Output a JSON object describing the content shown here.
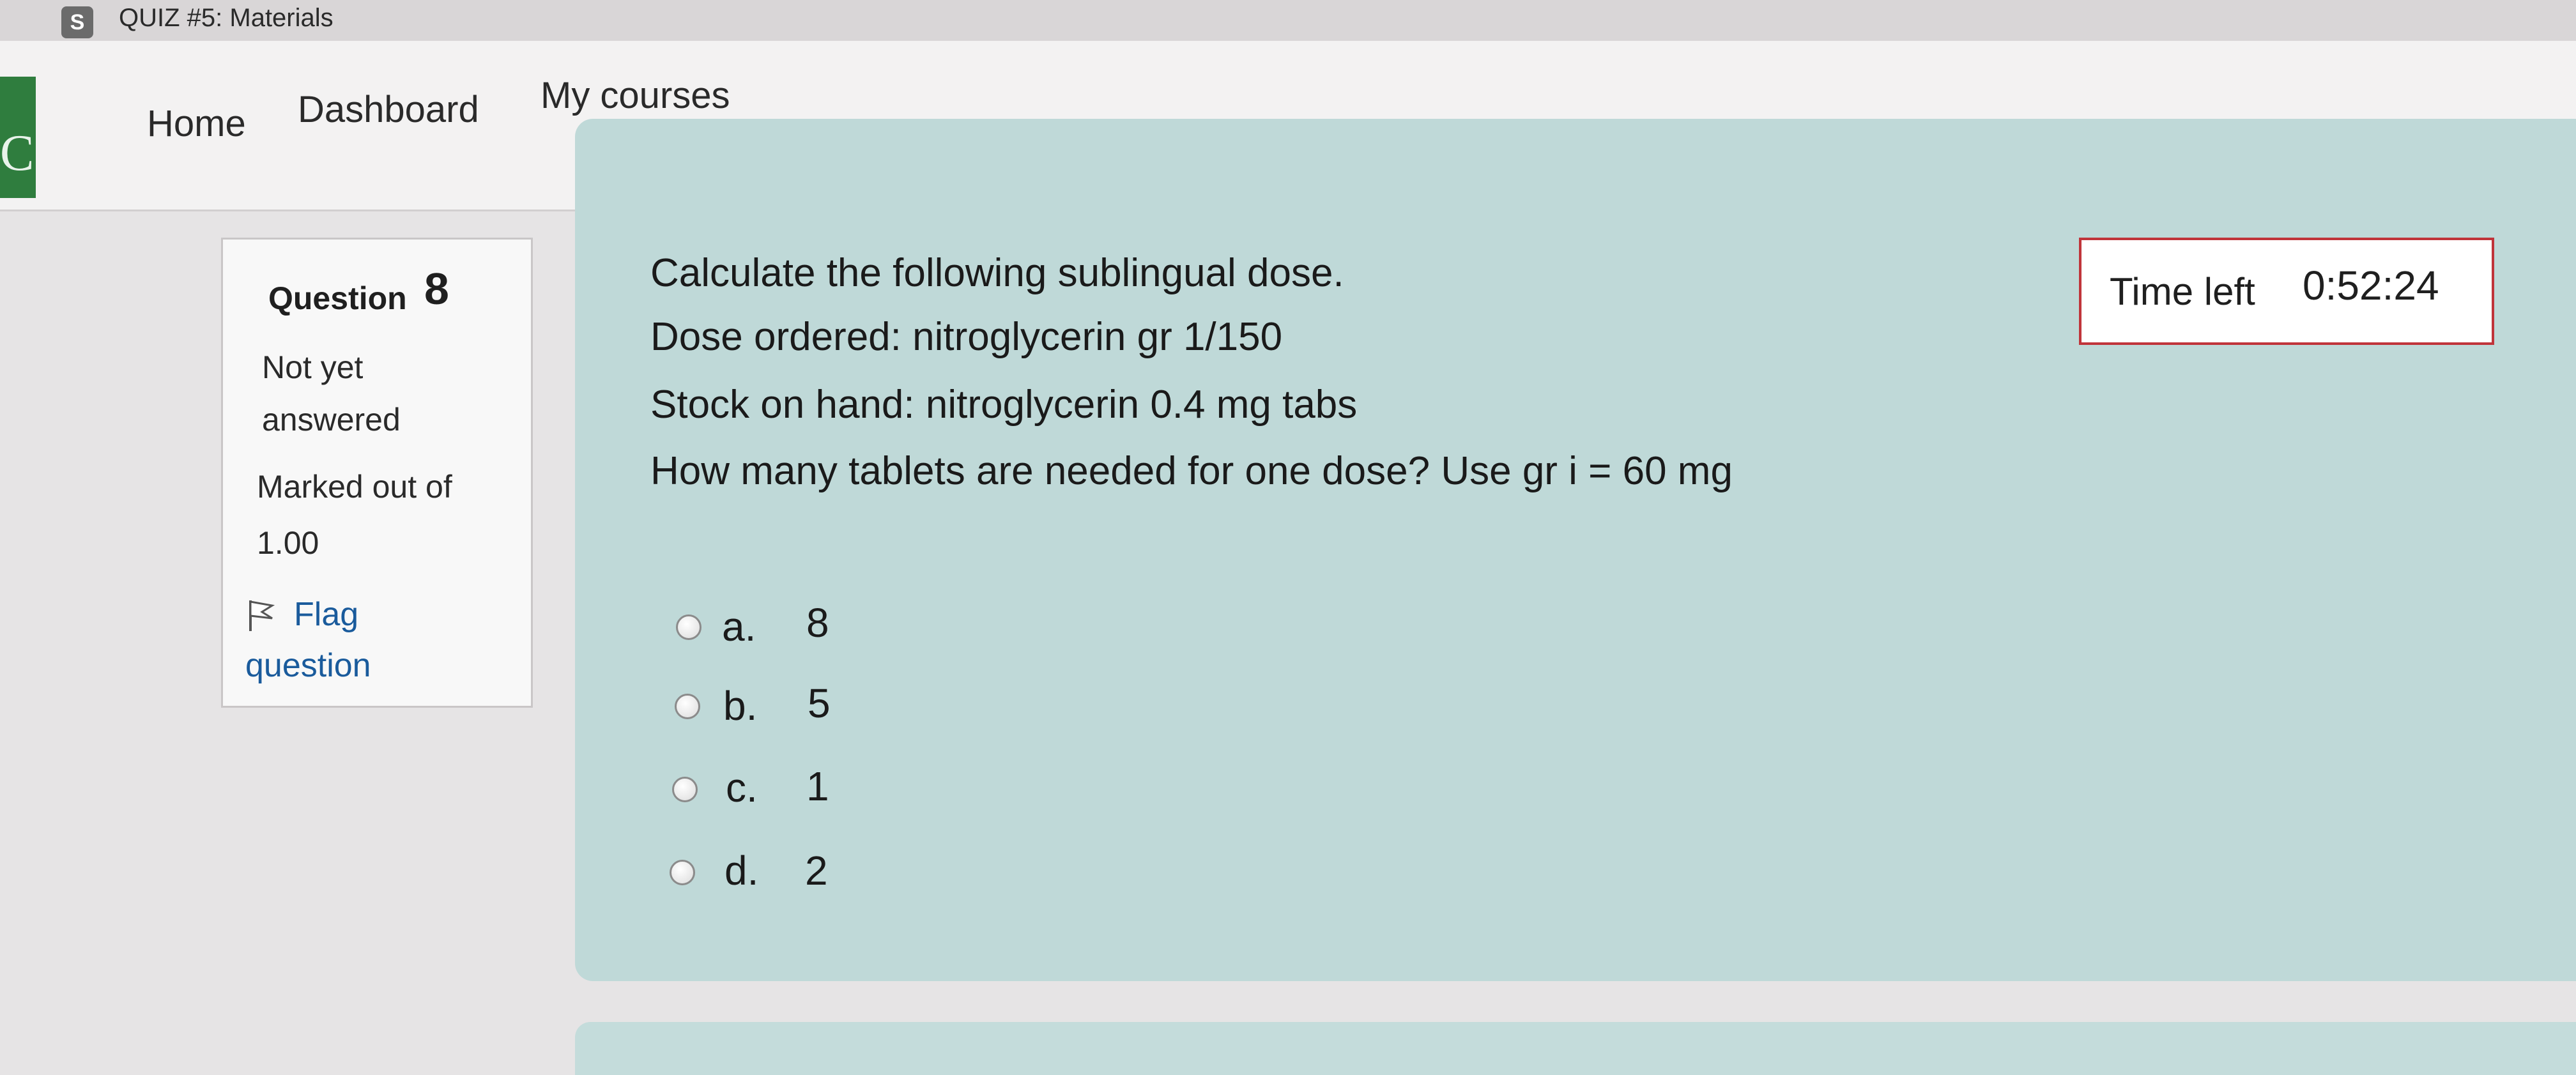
{
  "browser_tab": {
    "favicon": "S",
    "title": "QUIZ #5: Materials"
  },
  "site": {
    "logo_letter": "C",
    "nav": [
      {
        "label": "Home"
      },
      {
        "label": "Dashboard"
      },
      {
        "label": "My courses"
      }
    ]
  },
  "question_info": {
    "label": "Question",
    "number": "8",
    "status": "Not yet answered",
    "marked": "Marked out of 1.00",
    "flag_label": "Flag question",
    "flag_icon": "flag-icon"
  },
  "question": {
    "lines": [
      "Calculate the following sublingual dose.",
      "Dose ordered: nitroglycerin gr 1/150",
      "Stock on hand: nitroglycerin 0.4 mg tabs",
      "How many tablets are needed for one dose? Use gr i = 60 mg"
    ],
    "options": [
      {
        "letter": "a.",
        "value": "8"
      },
      {
        "letter": "b.",
        "value": "5"
      },
      {
        "letter": "c.",
        "value": "1"
      },
      {
        "letter": "d.",
        "value": "2"
      }
    ]
  },
  "timer": {
    "label": "Time left",
    "value": "0:52:24"
  },
  "colors": {
    "content_panel": "#bfd9d8",
    "timer_border": "#c0343a",
    "link": "#1a5b9c",
    "logo": "#2f7d3e"
  }
}
